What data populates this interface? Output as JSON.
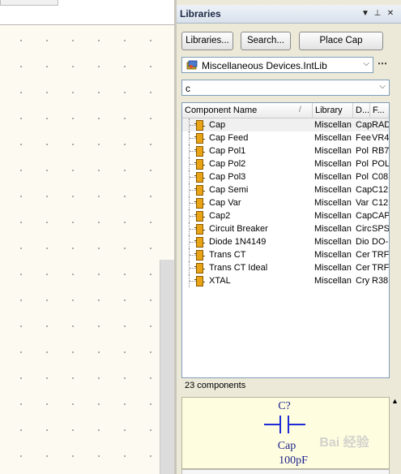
{
  "panel": {
    "title": "Libraries",
    "header_icons": [
      "dropdown-arrow-icon",
      "pin-icon",
      "close-icon"
    ],
    "header_glyphs": {
      "dropdown": "▼",
      "pin": "⊥",
      "close": "✕"
    }
  },
  "toolbar": {
    "libraries_label": "Libraries...",
    "search_label": "Search...",
    "place_label": "Place Cap"
  },
  "library_select": {
    "value": "Miscellaneous Devices.IntLib",
    "arrow": "⌵",
    "more": "⋯"
  },
  "filter": {
    "value": "c",
    "arrow": "⌵"
  },
  "columns": {
    "name": "Component Name",
    "sort": "/",
    "library": "Library",
    "description": "D...",
    "footprint": "F..."
  },
  "components": [
    {
      "name": "Cap",
      "library": "Miscellan",
      "desc": "Cap",
      "foot": "RAD"
    },
    {
      "name": "Cap Feed",
      "library": "Miscellan",
      "desc": "Fee",
      "foot": "VR4"
    },
    {
      "name": "Cap Pol1",
      "library": "Miscellan",
      "desc": "Pol",
      "foot": "RB7"
    },
    {
      "name": "Cap Pol2",
      "library": "Miscellan",
      "desc": "Pol",
      "foot": "POL"
    },
    {
      "name": "Cap Pol3",
      "library": "Miscellan",
      "desc": "Pol",
      "foot": "C08"
    },
    {
      "name": "Cap Semi",
      "library": "Miscellan",
      "desc": "Cap",
      "foot": "C12"
    },
    {
      "name": "Cap Var",
      "library": "Miscellan",
      "desc": "Var",
      "foot": "C12"
    },
    {
      "name": "Cap2",
      "library": "Miscellan",
      "desc": "Cap",
      "foot": "CAP"
    },
    {
      "name": "Circuit Breaker",
      "library": "Miscellan",
      "desc": "Circ",
      "foot": "SPS"
    },
    {
      "name": "Diode 1N4149",
      "library": "Miscellan",
      "desc": "Dio",
      "foot": "DO-"
    },
    {
      "name": "Trans CT",
      "library": "Miscellan",
      "desc": "Cer",
      "foot": "TRF"
    },
    {
      "name": "Trans CT Ideal",
      "library": "Miscellan",
      "desc": "Cer",
      "foot": "TRF"
    },
    {
      "name": "XTAL",
      "library": "Miscellan",
      "desc": "Cry",
      "foot": "R38"
    }
  ],
  "selected_index": 0,
  "count_label": "23 components",
  "preview": {
    "designator": "C?",
    "comment": "Cap",
    "value": "100pF",
    "symbol_color": "#1e2bd6",
    "text_color": "#1a1f8a"
  },
  "watermark": "Bai 经验"
}
